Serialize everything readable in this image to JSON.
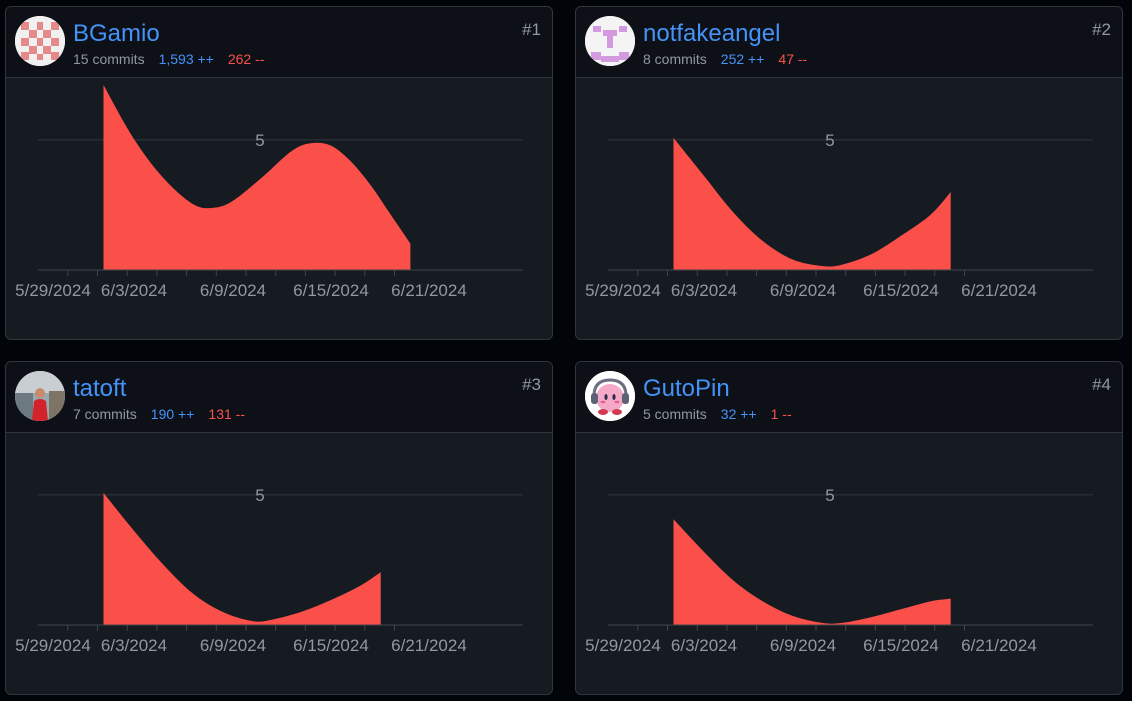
{
  "colors": {
    "accent_blue": "#4493f8",
    "deletions_red": "#f85149",
    "area_fill": "#fa5049",
    "card_bg": "#161b22",
    "header_bg": "#0d1117"
  },
  "contributors": [
    {
      "username": "BGamio",
      "commits": "15 commits",
      "additions": "1,593 ++",
      "deletions": "262 --",
      "rank": "#1",
      "avatar_icon": "identicon-avatar-pink",
      "chart_data": {
        "type": "area",
        "x": [
          "6/3/2024",
          "6/9/2024",
          "6/15/2024",
          "6/21/2024",
          "6/23/2024"
        ],
        "y_tick_labels": [
          "5"
        ],
        "x_tick_labels": [
          "5/29/2024",
          "6/3/2024",
          "6/9/2024",
          "6/15/2024",
          "6/21/2024"
        ],
        "ylim": [
          0,
          7
        ],
        "grid": true
      }
    },
    {
      "username": "notfakeangel",
      "commits": "8 commits",
      "additions": "252 ++",
      "deletions": "47 --",
      "rank": "#2",
      "avatar_icon": "identicon-avatar-purple",
      "chart_data": {
        "type": "area",
        "x": [
          "6/3/2024",
          "6/9/2024",
          "6/15/2024",
          "6/21/2024",
          "6/23/2024"
        ],
        "y_tick_labels": [
          "5"
        ],
        "x_tick_labels": [
          "5/29/2024",
          "6/3/2024",
          "6/9/2024",
          "6/15/2024",
          "6/21/2024"
        ],
        "ylim": [
          0,
          7
        ],
        "grid": true
      }
    },
    {
      "username": "tatoft",
      "commits": "7 commits",
      "additions": "190 ++",
      "deletions": "131 --",
      "rank": "#3",
      "avatar_icon": "photo-avatar",
      "chart_data": {
        "type": "area",
        "x": [
          "6/3/2024",
          "6/9/2024",
          "6/15/2024",
          "6/21/2024",
          "6/23/2024"
        ],
        "y_tick_labels": [
          "5"
        ],
        "x_tick_labels": [
          "5/29/2024",
          "6/3/2024",
          "6/9/2024",
          "6/15/2024",
          "6/21/2024"
        ],
        "ylim": [
          0,
          7
        ],
        "grid": true
      }
    },
    {
      "username": "GutoPin",
      "commits": "5 commits",
      "additions": "32 ++",
      "deletions": "1 --",
      "rank": "#4",
      "avatar_icon": "kirby-headphones-avatar",
      "chart_data": {
        "type": "area",
        "x": [
          "6/3/2024",
          "6/9/2024",
          "6/15/2024",
          "6/21/2024",
          "6/23/2024"
        ],
        "y_tick_labels": [
          "5"
        ],
        "x_tick_labels": [
          "5/29/2024",
          "6/3/2024",
          "6/9/2024",
          "6/15/2024",
          "6/21/2024"
        ],
        "ylim": [
          0,
          7
        ],
        "grid": true
      }
    }
  ]
}
